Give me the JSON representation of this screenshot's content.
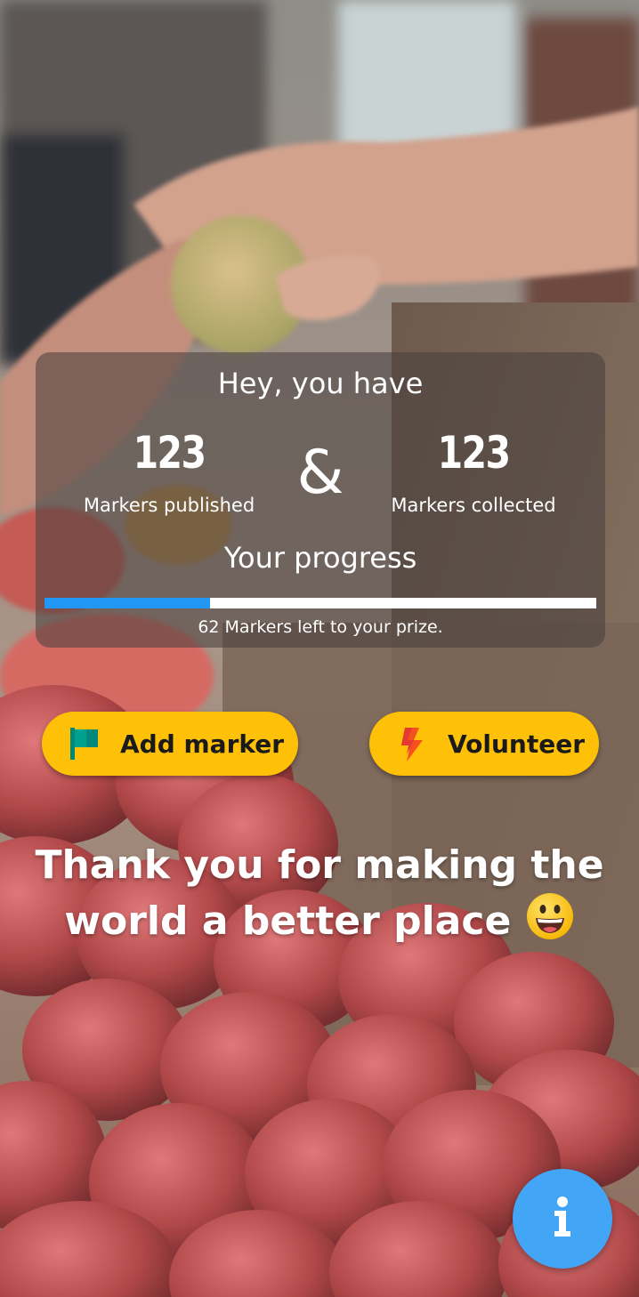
{
  "card": {
    "title": "Hey, you have",
    "published": {
      "count": "123",
      "label": "Markers published"
    },
    "collected": {
      "count": "123",
      "label": "Markers collected"
    },
    "ampersand": "&",
    "progress_title": "Your progress",
    "progress_fraction": 0.3,
    "progress_text": "62 Markers left to your prize."
  },
  "actions": {
    "add_marker": {
      "label": "Add marker",
      "icon": "flag-icon"
    },
    "volunteer": {
      "label": "Volunteer",
      "icon": "lightning-icon"
    }
  },
  "message": {
    "text": "Thank you for making the world a better place",
    "emoji": "grinning-face-emoji"
  },
  "fab": {
    "icon": "info-icon"
  },
  "colors": {
    "accent_yellow": "#ffc107",
    "progress_blue": "#2196f3",
    "fab_blue": "#42a5f5",
    "flag_teal": "#00897b",
    "lightning_red": "#f4511e"
  }
}
